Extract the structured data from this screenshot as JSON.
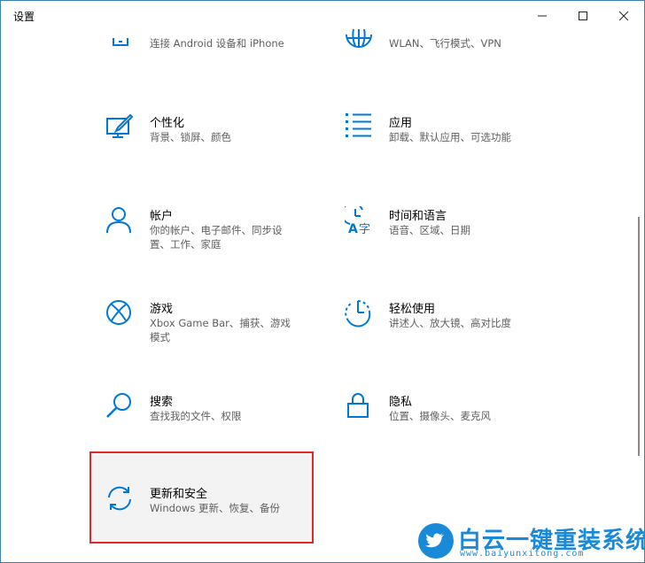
{
  "window": {
    "title": "设置",
    "controls": {
      "minimize_icon": "minimize-icon",
      "maximize_icon": "maximize-icon",
      "close_icon": "close-icon"
    },
    "accent_color": "#0078d4",
    "highlight_color": "#e02a2a"
  },
  "categories": {
    "phone": {
      "desc": "连接 Android 设备和 iPhone",
      "icon": "phone-icon"
    },
    "network": {
      "desc": "WLAN、飞行模式、VPN",
      "icon": "globe-icon"
    },
    "personalization": {
      "name": "个性化",
      "desc": "背景、锁屏、颜色",
      "icon": "paint-brush-monitor-icon"
    },
    "apps": {
      "name": "应用",
      "desc": "卸载、默认应用、可选功能",
      "icon": "apps-list-icon"
    },
    "accounts": {
      "name": "帐户",
      "desc_line1": "你的帐户、电子邮件、同步设",
      "desc_line2": "置、工作、家庭",
      "icon": "person-icon"
    },
    "time_language": {
      "name": "时间和语言",
      "desc": "语音、区域、日期",
      "icon": "time-language-icon"
    },
    "gaming": {
      "name": "游戏",
      "desc_line1": "Xbox Game Bar、捕获、游戏",
      "desc_line2": "模式",
      "icon": "xbox-icon"
    },
    "ease_of_access": {
      "name": "轻松使用",
      "desc": "讲述人、放大镜、高对比度",
      "icon": "ease-of-access-icon"
    },
    "search": {
      "name": "搜索",
      "desc": "查找我的文件、权限",
      "icon": "search-icon"
    },
    "privacy": {
      "name": "隐私",
      "desc": "位置、摄像头、麦克风",
      "icon": "lock-icon"
    },
    "update_security": {
      "name": "更新和安全",
      "desc": "Windows 更新、恢复、备份",
      "icon": "sync-arrows-icon"
    }
  },
  "watermark": {
    "title": "白云一键重装系统",
    "url": "www.baiyunxitong.com",
    "icon": "twitter-bird-icon",
    "color": "#1a8ad8"
  }
}
